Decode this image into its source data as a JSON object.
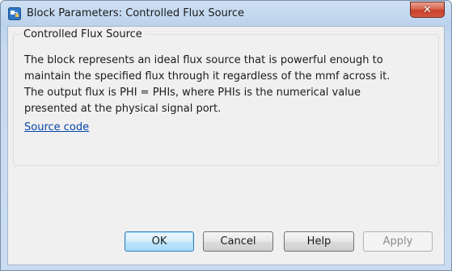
{
  "window": {
    "title": "Block Parameters: Controlled Flux Source",
    "close_glyph": "✕",
    "app_icon": "simulink-block-icon"
  },
  "group": {
    "label": "Controlled Flux Source",
    "description_lines": [
      "The block represents an ideal flux source that is powerful enough to",
      "maintain the specified flux through it regardless of the mmf across it.",
      "The output flux is PHI = PHIs, where PHIs is the numerical value",
      "presented at the physical signal port."
    ],
    "link_text": "Source code"
  },
  "buttons": {
    "ok": "OK",
    "cancel": "Cancel",
    "help": "Help",
    "apply": "Apply"
  },
  "colors": {
    "link": "#0645ad",
    "close_button": "#c8412a",
    "default_button_border": "#3c7fb1"
  }
}
